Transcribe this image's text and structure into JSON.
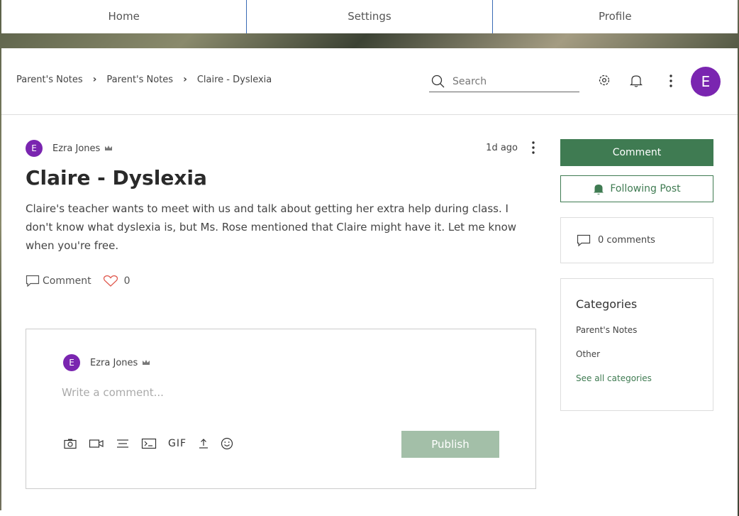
{
  "nav": {
    "items": [
      {
        "label": "Home"
      },
      {
        "label": "Settings"
      },
      {
        "label": "Profile"
      }
    ]
  },
  "breadcrumb": [
    "Parent's Notes",
    "Parent's Notes",
    "Claire - Dyslexia"
  ],
  "search": {
    "placeholder": "Search"
  },
  "user": {
    "initial": "E"
  },
  "post": {
    "author": "Ezra Jones",
    "author_initial": "E",
    "time": "1d ago",
    "title": "Claire - Dyslexia",
    "body": "Claire's teacher wants to meet with us and talk about getting her extra help during class. I don't know what dyslexia is, but Ms. Rose mentioned that Claire might have it. Let me know when you're free.",
    "comment_label": "Comment",
    "likes": "0"
  },
  "composer": {
    "author": "Ezra Jones",
    "author_initial": "E",
    "placeholder": "Write a comment...",
    "gif_label": "GIF",
    "publish_label": "Publish"
  },
  "sidebar": {
    "comment_button": "Comment",
    "follow_button": "Following Post",
    "comments_count": "0 comments",
    "categories_title": "Categories",
    "categories": [
      "Parent's Notes",
      "Other"
    ],
    "see_all": "See all categories"
  },
  "colors": {
    "accent_green": "#3f7b52",
    "avatar_purple": "#7a25b0",
    "publish_disabled": "#a3bfa8",
    "like_heart": "#e05a4f"
  }
}
